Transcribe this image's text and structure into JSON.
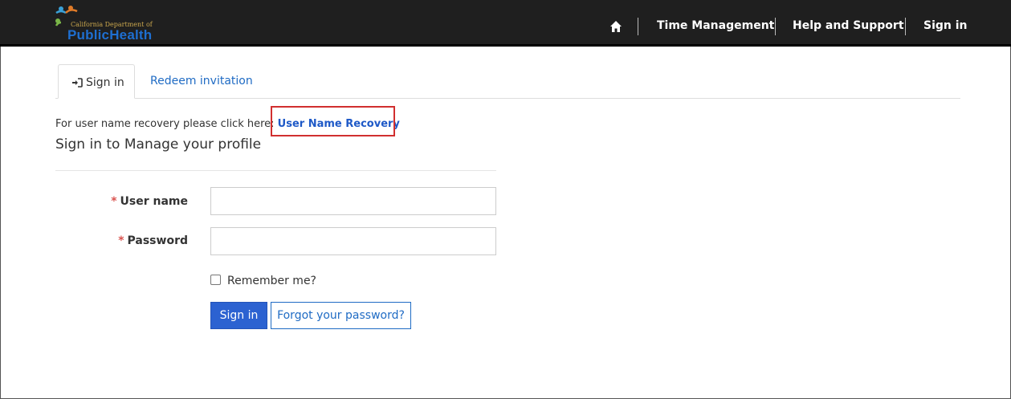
{
  "header": {
    "logo": {
      "small_text": "California Department of",
      "brand": "PublicHealth"
    },
    "nav": {
      "home_icon": "home-icon",
      "time_management": "Time Management",
      "help_support": "Help and Support",
      "sign_in": "Sign in"
    }
  },
  "tabs": {
    "sign_in": "Sign in",
    "sign_in_icon": "sign-in-icon",
    "redeem": "Redeem invitation"
  },
  "recovery": {
    "prompt": "For user name recovery please click here: ",
    "link": "User Name Recovery"
  },
  "page_title": "Sign in to Manage your profile",
  "form": {
    "required_mark": "*",
    "username_label": "User name",
    "username_value": "",
    "password_label": "Password",
    "password_value": "",
    "remember_label": "Remember me?",
    "remember_checked": false,
    "sign_in_button": "Sign in",
    "forgot_button": "Forgot your password?"
  },
  "colors": {
    "topbar": "#1f1f1f",
    "link": "#1f6bc4",
    "primary_button": "#2c62d1",
    "highlight": "#d12f2f",
    "required": "#d9534f"
  }
}
